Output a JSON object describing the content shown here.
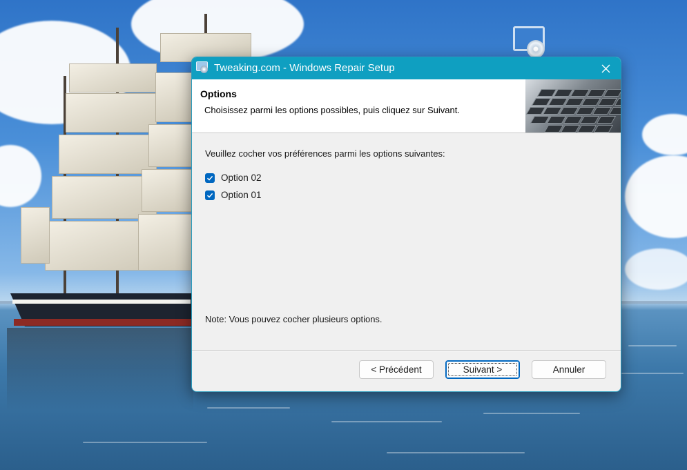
{
  "dialog": {
    "title": "Tweaking.com - Windows Repair Setup",
    "header_title": "Options",
    "header_subtitle": "Choisissez parmi les options possibles, puis cliquez sur Suivant.",
    "prompt": "Veuillez cocher vos préférences parmi les options suivantes:",
    "options": [
      {
        "label": "Option 02",
        "checked": true
      },
      {
        "label": "Option 01",
        "checked": true
      }
    ],
    "note": "Note: Vous pouvez cocher plusieurs options.",
    "buttons": {
      "back": "< Précédent",
      "next": "Suivant >",
      "cancel": "Annuler"
    }
  },
  "colors": {
    "titlebar": "#0f9fc1",
    "checkbox": "#0067c0"
  },
  "icons": [
    "app-setup-icon",
    "close-icon",
    "check-icon",
    "desktop-setup-icon"
  ]
}
